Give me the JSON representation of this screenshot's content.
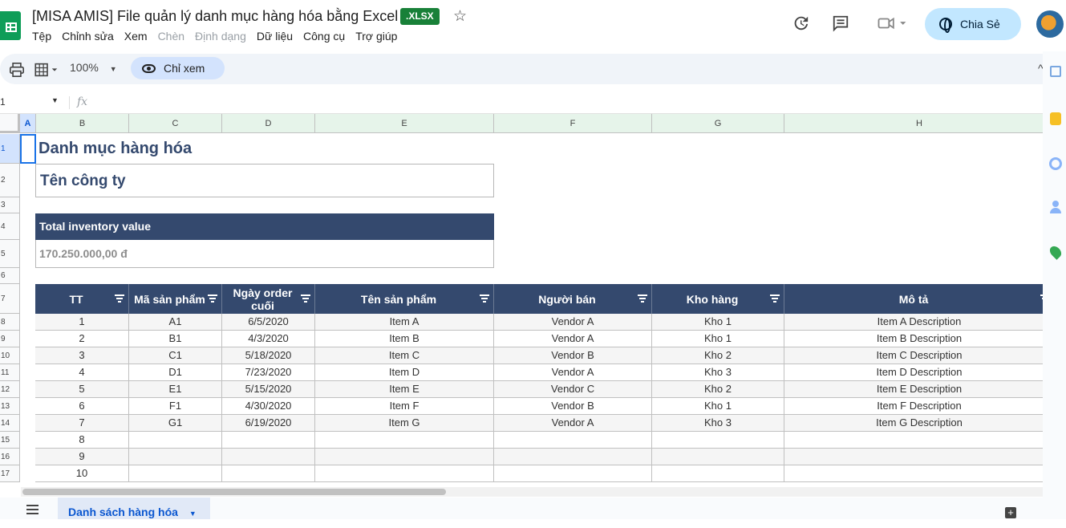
{
  "doc": {
    "title": "[MISA AMIS] File quản lý danh mục hàng hóa bằng Excel",
    "format_badge": ".XLSX"
  },
  "menu": [
    {
      "label": "Tệp",
      "enabled": true
    },
    {
      "label": "Chỉnh sửa",
      "enabled": true
    },
    {
      "label": "Xem",
      "enabled": true
    },
    {
      "label": "Chèn",
      "enabled": false
    },
    {
      "label": "Định dạng",
      "enabled": false
    },
    {
      "label": "Dữ liệu",
      "enabled": true
    },
    {
      "label": "Công cụ",
      "enabled": true
    },
    {
      "label": "Trợ giúp",
      "enabled": true
    }
  ],
  "share_label": "Chia Sẻ",
  "toolbar": {
    "zoom": "100%",
    "view_mode": "Chỉ xem"
  },
  "formula": {
    "name_box": "1",
    "fx": "fx"
  },
  "columns": [
    "A",
    "B",
    "C",
    "D",
    "E",
    "F",
    "G",
    "H"
  ],
  "rows": [
    "1",
    "2",
    "3",
    "4",
    "5",
    "6",
    "7",
    "8",
    "9",
    "10",
    "11",
    "12",
    "13",
    "14",
    "15",
    "16",
    "17"
  ],
  "sheet": {
    "title": "Danh mục hàng hóa",
    "company": "Tên công ty",
    "inventory_label": "Total inventory value",
    "inventory_value": "170.250.000,00 đ",
    "headers": [
      "TT",
      "Mã sản phẩm",
      "Ngày order cuối",
      "Tên sản phẩm",
      "Người bán",
      "Kho hàng",
      "Mô tả"
    ],
    "items": [
      [
        "1",
        "A1",
        "6/5/2020",
        "Item A",
        "Vendor A",
        "Kho 1",
        "Item A Description"
      ],
      [
        "2",
        "B1",
        "4/3/2020",
        "Item B",
        "Vendor A",
        "Kho 1",
        "Item B Description"
      ],
      [
        "3",
        "C1",
        "5/18/2020",
        "Item C",
        "Vendor B",
        "Kho 2",
        "Item C Description"
      ],
      [
        "4",
        "D1",
        "7/23/2020",
        "Item D",
        "Vendor A",
        "Kho 3",
        "Item D Description"
      ],
      [
        "5",
        "E1",
        "5/15/2020",
        "Item E",
        "Vendor C",
        "Kho 2",
        "Item E Description"
      ],
      [
        "6",
        "F1",
        "4/30/2020",
        "Item F",
        "Vendor B",
        "Kho 1",
        "Item F Description"
      ],
      [
        "7",
        "G1",
        "6/19/2020",
        "Item G",
        "Vendor A",
        "Kho 3",
        "Item G Description"
      ],
      [
        "8",
        "",
        "",
        "",
        "",
        "",
        ""
      ],
      [
        "9",
        "",
        "",
        "",
        "",
        "",
        ""
      ],
      [
        "10",
        "",
        "",
        "",
        "",
        "",
        ""
      ]
    ]
  },
  "sheet_tab": "Danh sách hàng hóa",
  "icons": {
    "history": "history-icon",
    "comment": "comment-icon",
    "meet": "video-icon",
    "print": "print-icon",
    "format": "table-format-icon"
  }
}
